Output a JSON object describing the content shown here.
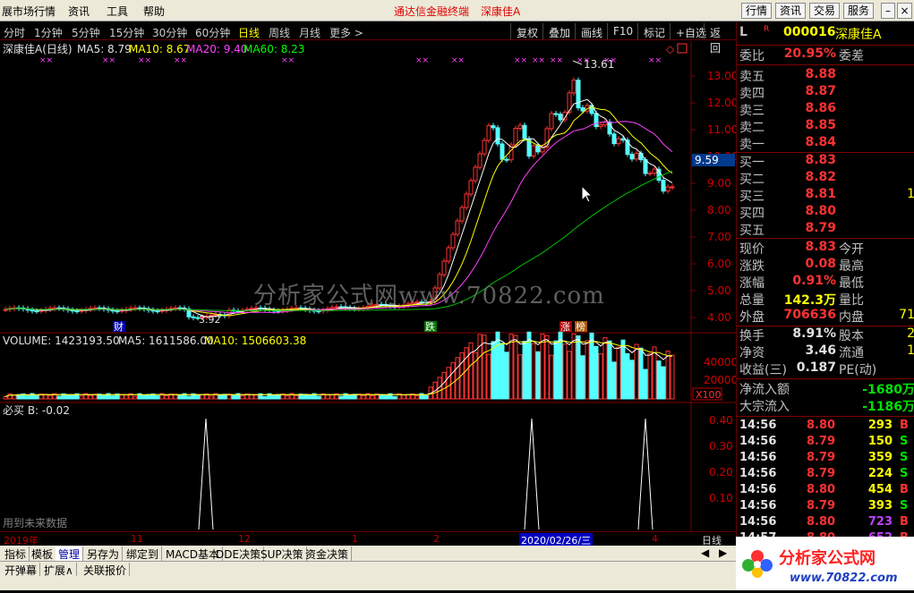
{
  "menubar": {
    "items": [
      "展市场行情",
      "资讯",
      "工具",
      "帮助"
    ],
    "center_title": "通达信金融终端",
    "center_stock": "深康佳A",
    "right_buttons": [
      "行情",
      "资讯",
      "交易",
      "服务"
    ]
  },
  "periods": [
    "分时",
    "1分钟",
    "5分钟",
    "15分钟",
    "30分钟",
    "60分钟",
    "日线",
    "周线",
    "月线",
    "更多 >"
  ],
  "active_period": "日线",
  "tools": [
    "复权",
    "叠加",
    "画线",
    "F10",
    "标记",
    "+自选",
    "返回"
  ],
  "main_chart": {
    "title": "深康佳A(日线)",
    "ma5": "MA5: 8.79",
    "ma10": "MA10: 8.67",
    "ma20": "MA20: 9.40",
    "ma60": "MA60: 8.23",
    "high_label": "13.61",
    "low_label": "3.92",
    "current_price_tag": "9.59",
    "price_ticks": [
      "13.00",
      "12.00",
      "11.00",
      "10.00",
      "9.00",
      "8.00",
      "7.00",
      "6.00",
      "5.00",
      "4.00"
    ],
    "event_labels": [
      "财",
      "跌",
      "涨",
      "榜"
    ],
    "watermark": "分析家公式网www.70822.com"
  },
  "volume_chart": {
    "title": "VOLUME: 1423193.50",
    "ma5": "MA5: 1611586.00",
    "ma10": "MA10: 1506603.38",
    "ticks": [
      "40000",
      "20000"
    ],
    "unit": "X100"
  },
  "indicator": {
    "title": "必买 B: -0.02",
    "ticks": [
      "0.40",
      "0.30",
      "0.20",
      "0.10"
    ],
    "note": "用到未来数据"
  },
  "time_axis": {
    "labels": [
      "2019年",
      "11",
      "12",
      "1",
      "2",
      "2020/02/26/三",
      "4"
    ],
    "period": "日线"
  },
  "bottom_tabs1": [
    "指标",
    "模板",
    "管理",
    "另存为",
    "绑定到",
    "MACD基本",
    "DDE决策",
    "SUP决策",
    "资金决策"
  ],
  "bottom_tabs2": [
    "开弹幕",
    "扩展∧",
    "关联报价"
  ],
  "quote": {
    "code": "000016",
    "name": "深康佳A",
    "weibi_label": "委比",
    "weibi": "20.95%",
    "weicha_label": "委差",
    "sell": [
      {
        "label": "卖五",
        "price": "8.88"
      },
      {
        "label": "卖四",
        "price": "8.87"
      },
      {
        "label": "卖三",
        "price": "8.86"
      },
      {
        "label": "卖二",
        "price": "8.85"
      },
      {
        "label": "卖一",
        "price": "8.84"
      }
    ],
    "buy": [
      {
        "label": "买一",
        "price": "8.83"
      },
      {
        "label": "买二",
        "price": "8.82"
      },
      {
        "label": "买三",
        "price": "8.81",
        "vol": "1"
      },
      {
        "label": "买四",
        "price": "8.80"
      },
      {
        "label": "买五",
        "price": "8.79"
      }
    ],
    "stats": [
      {
        "l": "现价",
        "v": "8.83",
        "l2": "今开",
        "v2": ""
      },
      {
        "l": "涨跌",
        "v": "0.08",
        "l2": "最高",
        "v2": ""
      },
      {
        "l": "涨幅",
        "v": "0.91%",
        "l2": "最低",
        "v2": ""
      },
      {
        "l": "总量",
        "v": "142.3万",
        "l2": "量比",
        "v2": ""
      },
      {
        "l": "外盘",
        "v": "706636",
        "l2": "内盘",
        "v2": "71"
      }
    ],
    "stats2": [
      {
        "l": "换手",
        "v": "8.91%",
        "l2": "股本",
        "v2": "2"
      },
      {
        "l": "净资",
        "v": "3.46",
        "l2": "流通",
        "v2": "1"
      },
      {
        "l": "收益(三)",
        "v": "0.187",
        "l2": "PE(动)",
        "v2": ""
      }
    ],
    "flows": [
      {
        "l": "净流入额",
        "v": "-1680万"
      },
      {
        "l": "大宗流入",
        "v": "-1186万"
      }
    ],
    "ticks": [
      {
        "t": "14:56",
        "p": "8.80",
        "q": "293",
        "s": "B"
      },
      {
        "t": "14:56",
        "p": "8.79",
        "q": "150",
        "s": "S"
      },
      {
        "t": "14:56",
        "p": "8.79",
        "q": "359",
        "s": "S"
      },
      {
        "t": "14:56",
        "p": "8.79",
        "q": "224",
        "s": "S"
      },
      {
        "t": "14:56",
        "p": "8.80",
        "q": "454",
        "s": "B"
      },
      {
        "t": "14:56",
        "p": "8.79",
        "q": "393",
        "s": "S"
      },
      {
        "t": "14:56",
        "p": "8.80",
        "q": "723",
        "s": "B"
      },
      {
        "t": "14:57",
        "p": "8.80",
        "q": "652",
        "s": "B"
      }
    ]
  },
  "logo": {
    "text": "分析家公式网",
    "url": "www.70822.com"
  }
}
